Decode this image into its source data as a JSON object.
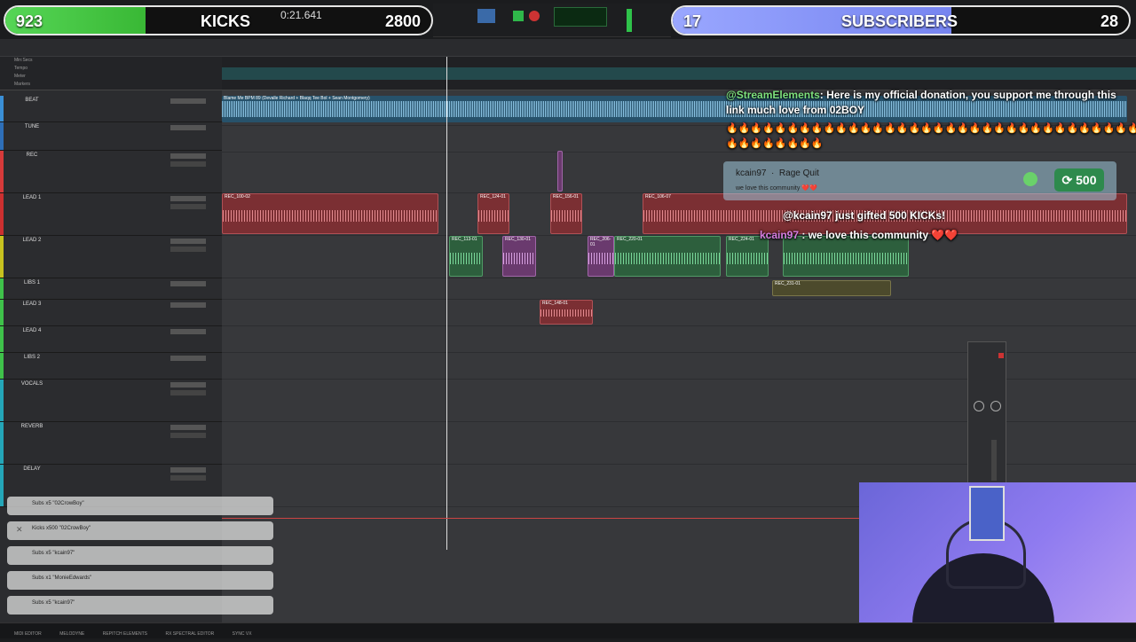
{
  "overlay": {
    "kicks_left": "923",
    "kicks_label": "KICKS",
    "kicks_right": "2800",
    "subs_left": "17",
    "subs_label": "SUBSCRIBERS",
    "subs_right": "28",
    "kicks_progress": 0.33,
    "subs_progress": 0.61
  },
  "transport": {
    "counter": "0:21.641"
  },
  "ruler_labels": [
    "Min:Secs",
    "Tempo",
    "Meter",
    "Markers"
  ],
  "tracks": [
    {
      "name": "BEAT",
      "color": "#3a8fd6"
    },
    {
      "name": "TUNE",
      "color": "#2e6fb8"
    },
    {
      "name": "REC",
      "color": "#d63a3a"
    },
    {
      "name": "LEAD 1",
      "color": "#cc3030"
    },
    {
      "name": "LEAD 2",
      "color": "#c7c21f"
    },
    {
      "name": "LIBS 1",
      "color": "#3fc24a"
    },
    {
      "name": "LEAD 3",
      "color": "#3fc24a"
    },
    {
      "name": "LEAD 4",
      "color": "#3fc24a"
    },
    {
      "name": "LIBS 2",
      "color": "#3fc24a"
    },
    {
      "name": "VOCALS",
      "color": "#24a6b8"
    },
    {
      "name": "REVERB",
      "color": "#24a6b8"
    },
    {
      "name": "DELAY",
      "color": "#24a6b8"
    }
  ],
  "clips": {
    "beat": "Blame Me BPM 89 (Devalle Richard + Blaqq Tee Bol + Sean Montgomery)",
    "lead1": [
      "REC_100-02",
      "REC_124-01",
      "REC_156-01",
      "REC_106-07"
    ],
    "lead2": [
      "REC_113-01",
      "REC_130-01",
      "REC_206-01",
      "REC_220-01",
      "REC_224-01"
    ],
    "libs1": "REC_231-01",
    "lead3": "REC_148-01"
  },
  "chat": {
    "donation_user": "@StreamElements",
    "donation_text": ": Here is my official donation, you support me through this link much love from 02BOY",
    "fire_row_1": "🔥🔥🔥🔥🔥🔥🔥🔥🔥🔥🔥🔥🔥🔥🔥🔥🔥🔥🔥🔥🔥🔥🔥🔥🔥🔥🔥🔥🔥🔥🔥🔥🔥🔥🔥",
    "fire_row_2": "🔥🔥🔥🔥🔥🔥🔥🔥",
    "gift_text": "@kcain97 just gifted 500 KICKs!",
    "comment_user": "kcain97",
    "comment_text": ": we love this community ❤️❤️"
  },
  "rage": {
    "user": "kcain97",
    "label": "Rage Quit",
    "message": "we love this community ❤️❤️",
    "amount": "500"
  },
  "events": [
    "Subs x5 \"02CrowBoy\"",
    "Kicks x500 \"02CrowBoy\"",
    "Subs x5 \"kcain97\"",
    "Subs x1 \"MonieEdwards\"",
    "Subs x5 \"kcain97\""
  ],
  "bottom_bar": [
    "MIDI EDITOR",
    "MELODYNE",
    "REPITCH ELEMENTS",
    "RX SPECTRAL EDITOR",
    "SYNC VX"
  ],
  "colors": {
    "kicks_fill": "#56d656",
    "subs_fill": "#7e8bf2",
    "playhead": "#dddddd"
  }
}
